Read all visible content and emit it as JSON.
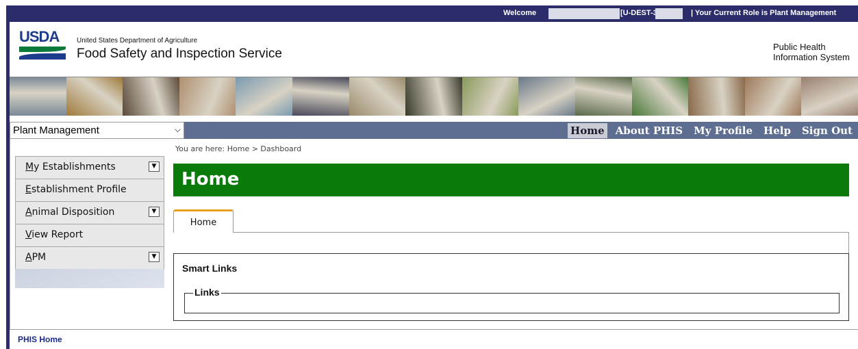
{
  "topbar": {
    "welcome_label": "Welcome",
    "user_fragment": "[U-DEST-3!",
    "role_text": "| Your Current Role is Plant Management"
  },
  "header": {
    "logo_text": "USDA",
    "department": "United States Department of Agriculture",
    "agency": "Food Safety and Inspection Service",
    "system_line1": "Public Health",
    "system_line2": "Information System"
  },
  "photostrip": {
    "colors": [
      "#7a8a98",
      "#a07a3a",
      "#5a4a3a",
      "#b09070",
      "#7a9ab0",
      "#4a4a5a",
      "#9a8a6a",
      "#3a3a2a",
      "#8a9a5a",
      "#6a7a8a",
      "#5a6a4a",
      "#4a7a3a",
      "#8a6a4a",
      "#a07a5a",
      "#9a8070"
    ]
  },
  "navbar": {
    "role_selected": "Plant Management",
    "links": [
      "Home",
      "About PHIS",
      "My Profile",
      "Help",
      "Sign Out"
    ]
  },
  "leftmenu": {
    "items": [
      {
        "label_first": "M",
        "label_rest": "y Establishments",
        "has_dropdown": true
      },
      {
        "label_first": "E",
        "label_rest": "stablishment Profile",
        "has_dropdown": false
      },
      {
        "label_first": "A",
        "label_rest": "nimal Disposition",
        "has_dropdown": true
      },
      {
        "label_first": "V",
        "label_rest": "iew Report",
        "has_dropdown": false
      },
      {
        "label_first": "A",
        "label_rest": "PM",
        "has_dropdown": true
      }
    ]
  },
  "main": {
    "breadcrumb": "You are here: Home > Dashboard",
    "page_title": "Home",
    "tab_label": "Home",
    "smart_links_title": "Smart Links",
    "links_legend": "Links"
  },
  "footer": {
    "link_label": "PHIS Home"
  },
  "colors": {
    "frame": "#2b2d6b",
    "title_bar": "#0a7a0a",
    "nav": "#5d6e90",
    "tab_accent": "#e8a020"
  }
}
